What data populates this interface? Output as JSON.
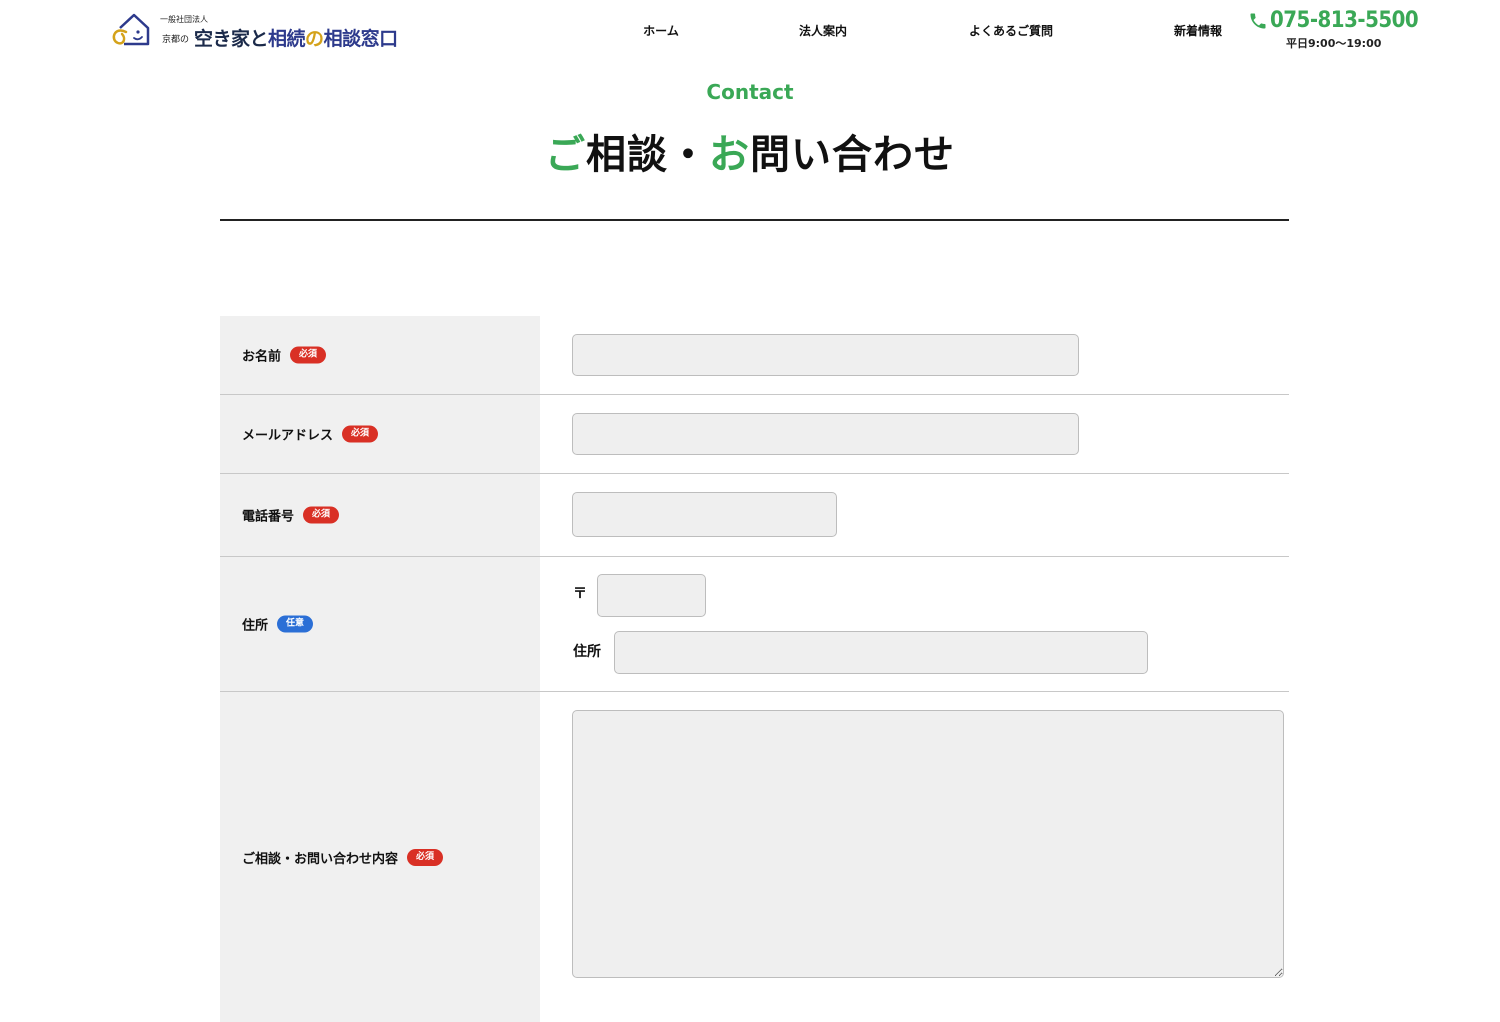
{
  "header": {
    "logo": {
      "org_type": "一般社団法人",
      "prefix": "京都の",
      "title_part1": "空き家",
      "title_part2": "と",
      "title_part3": "相続",
      "title_part4": "の",
      "title_part5": "相談窓口"
    },
    "nav": [
      {
        "label": "ホーム"
      },
      {
        "label": "法人案内"
      },
      {
        "label": "よくあるご質問"
      },
      {
        "label": "新着情報"
      }
    ],
    "phone": {
      "number": "075-813-5500",
      "hours": "平日9:00〜19:00"
    }
  },
  "page": {
    "eyebrow": "Contact",
    "title_char1": "ご",
    "title_part2": "相談・",
    "title_char3": "お",
    "title_part4": "問い合わせ"
  },
  "form": {
    "name": {
      "label": "お名前",
      "badge": "必須",
      "value": ""
    },
    "email": {
      "label": "メールアドレス",
      "badge": "必須",
      "value": ""
    },
    "tel": {
      "label": "電話番号",
      "badge": "必須",
      "value": ""
    },
    "address": {
      "label": "住所",
      "badge": "任意",
      "zip_prefix": "〒",
      "zip_value": "",
      "address_label": "住所",
      "address_value": ""
    },
    "inquiry": {
      "label": "ご相談・お問い合わせ内容",
      "badge": "必須",
      "value": ""
    }
  },
  "colors": {
    "accent_green": "#3aa856",
    "required_red": "#d93025",
    "optional_blue": "#2b6fd6",
    "label_bg": "#f0f0f0"
  }
}
